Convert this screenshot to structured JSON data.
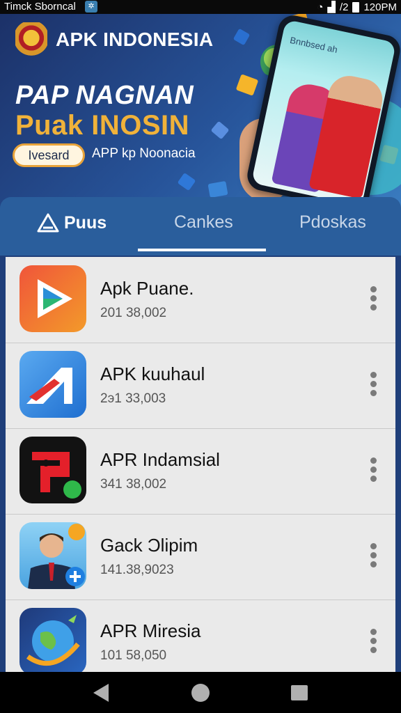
{
  "status_bar": {
    "left_text": "Timck Sborncal",
    "signal_text": "/2",
    "time": "120PM"
  },
  "header": {
    "brand": "APK INDONESIA",
    "hero_title_1": "PAP NAGNAN",
    "hero_title_2": "Puak INOSIN",
    "hero_button": "Ivesard",
    "hero_subtitle": "APP kp Noonacia",
    "phone_screen_text": "Bnnbsed ah"
  },
  "tabs": [
    {
      "label": "Puus",
      "active": true
    },
    {
      "label": "Cankes",
      "active": false
    },
    {
      "label": "Pdoskas",
      "active": false
    }
  ],
  "apps": [
    {
      "name": "Apk Puane.",
      "meta": "201 38,002",
      "icon": "play-store-icon"
    },
    {
      "name": "APK kuuhaul",
      "meta": "2э1 33,003",
      "icon": "blue-a-logo-icon"
    },
    {
      "name": "APR Indamsial",
      "meta": "341 38,002",
      "icon": "red-pp-icon"
    },
    {
      "name": "Gack Ͻlipim",
      "meta": "141.38,9023",
      "icon": "man-avatar-icon"
    },
    {
      "name": "APR Miresia",
      "meta": "101 58,050",
      "icon": "globe-icon"
    }
  ],
  "colors": {
    "header_bg": "#1f3f7a",
    "tab_bg": "#2a5e9c",
    "accent": "#f0b23a",
    "list_bg": "#eaeaea"
  }
}
